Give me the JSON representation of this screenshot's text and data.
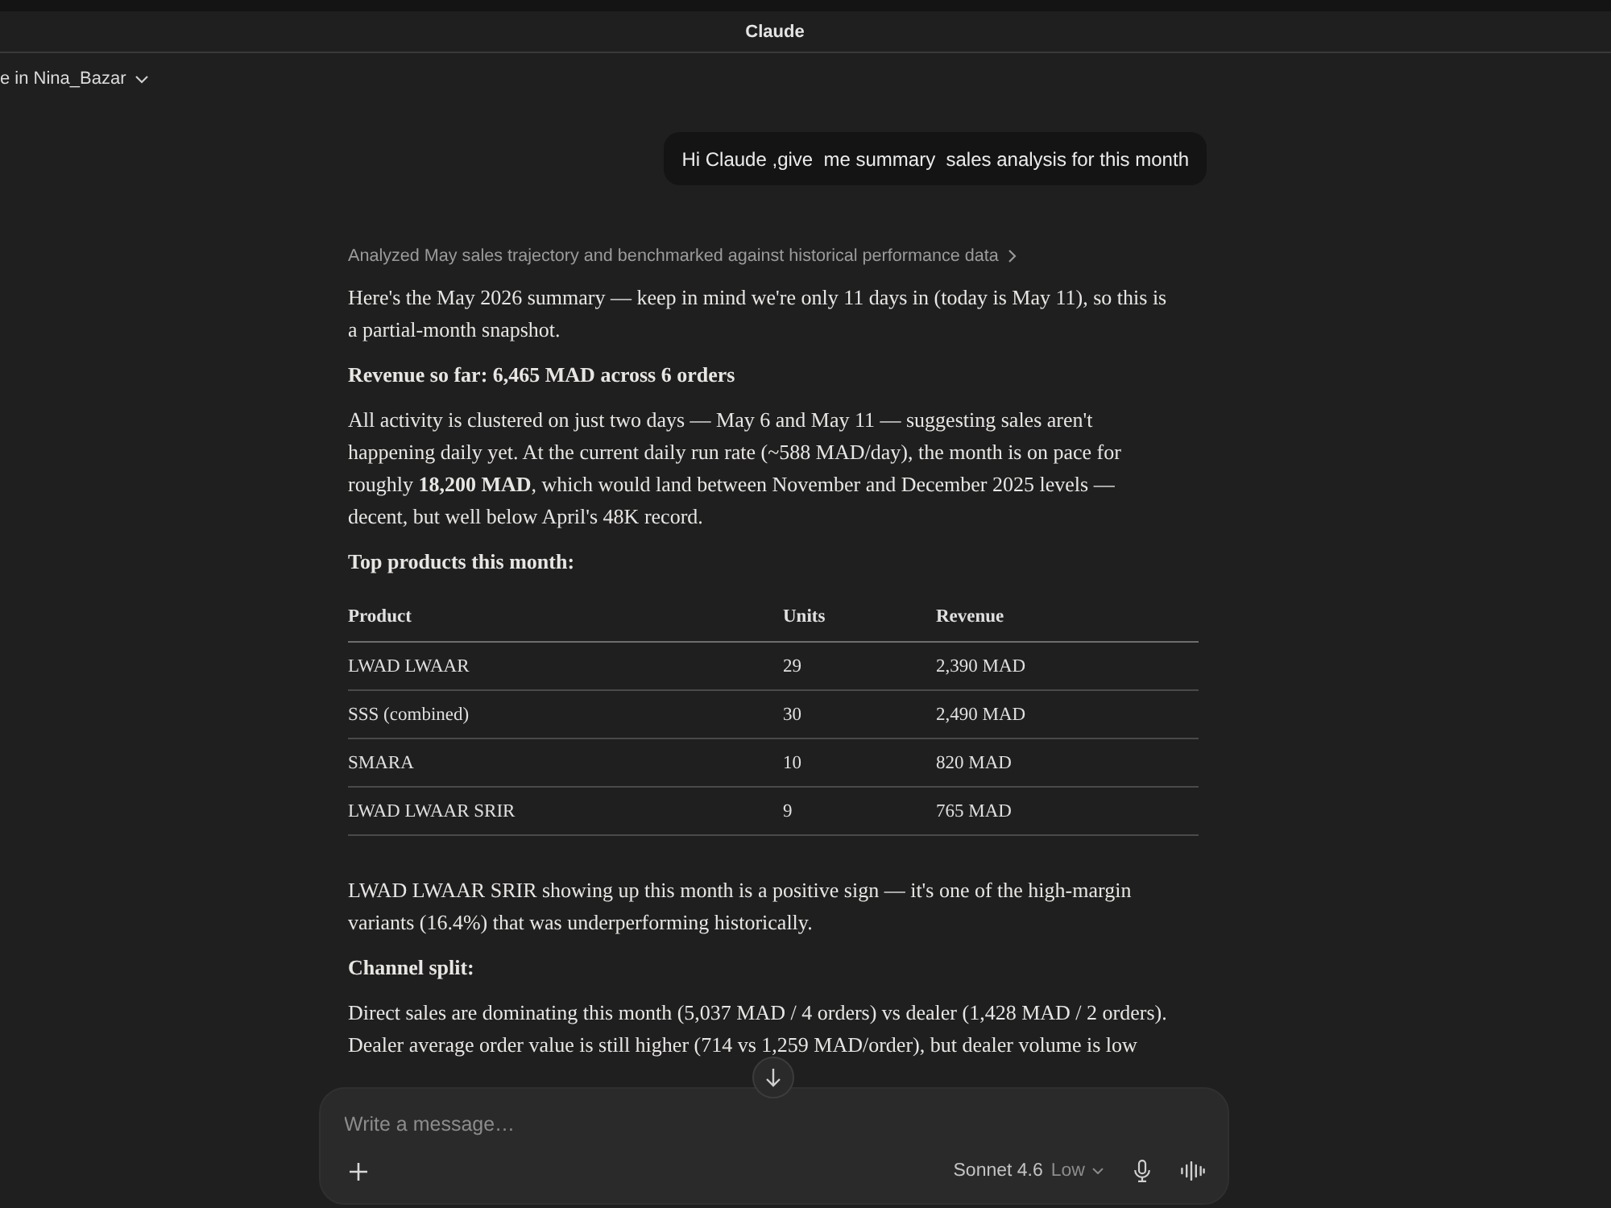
{
  "window": {
    "title": "Claude"
  },
  "project_selector": {
    "label": "e in Nina_Bazar"
  },
  "conversation": {
    "user_message": "Hi Claude ,give  me summary  sales analysis for this month",
    "thinking_summary": "Analyzed May sales trajectory and benchmarked against historical performance data",
    "response": [
      {
        "kind": "paragraph",
        "text": "Here's the May 2026 summary — keep in mind we're only 11 days in (today is May 11), so this is a partial-month snapshot."
      },
      {
        "kind": "heading",
        "text": "Revenue so far: 6,465 MAD across 6 orders"
      },
      {
        "kind": "paragraph",
        "text": "All activity is clustered on just two days — May 6 and May 11 — suggesting sales aren't happening daily yet. At the current daily run rate (~588 MAD/day), the month is on pace for roughly **18,200 MAD**, which would land between November and December 2025 levels — decent, but well below April's 48K record."
      },
      {
        "kind": "heading",
        "text": "Top products this month:"
      },
      {
        "kind": "table",
        "columns": [
          "Product",
          "Units",
          "Revenue"
        ],
        "rows": [
          [
            "LWAD LWAAR",
            "29",
            "2,390 MAD"
          ],
          [
            "SSS (combined)",
            "30",
            "2,490 MAD"
          ],
          [
            "SMARA",
            "10",
            "820 MAD"
          ],
          [
            "LWAD LWAAR SRIR",
            "9",
            "765 MAD"
          ]
        ]
      },
      {
        "kind": "paragraph",
        "text": "LWAD LWAAR SRIR showing up this month is a positive sign — it's one of the high-margin variants (16.4%) that was underperforming historically."
      },
      {
        "kind": "heading",
        "text": "Channel split:"
      },
      {
        "kind": "paragraph",
        "text": "Direct sales are dominating this month (5,037 MAD / 4 orders) vs dealer (1,428 MAD / 2 orders). Dealer average order value is still higher (714 vs 1,259 MAD/order), but dealer volume is low"
      }
    ]
  },
  "composer": {
    "placeholder": "Write a message…",
    "model": "Sonnet 4.6",
    "effort": "Low"
  }
}
